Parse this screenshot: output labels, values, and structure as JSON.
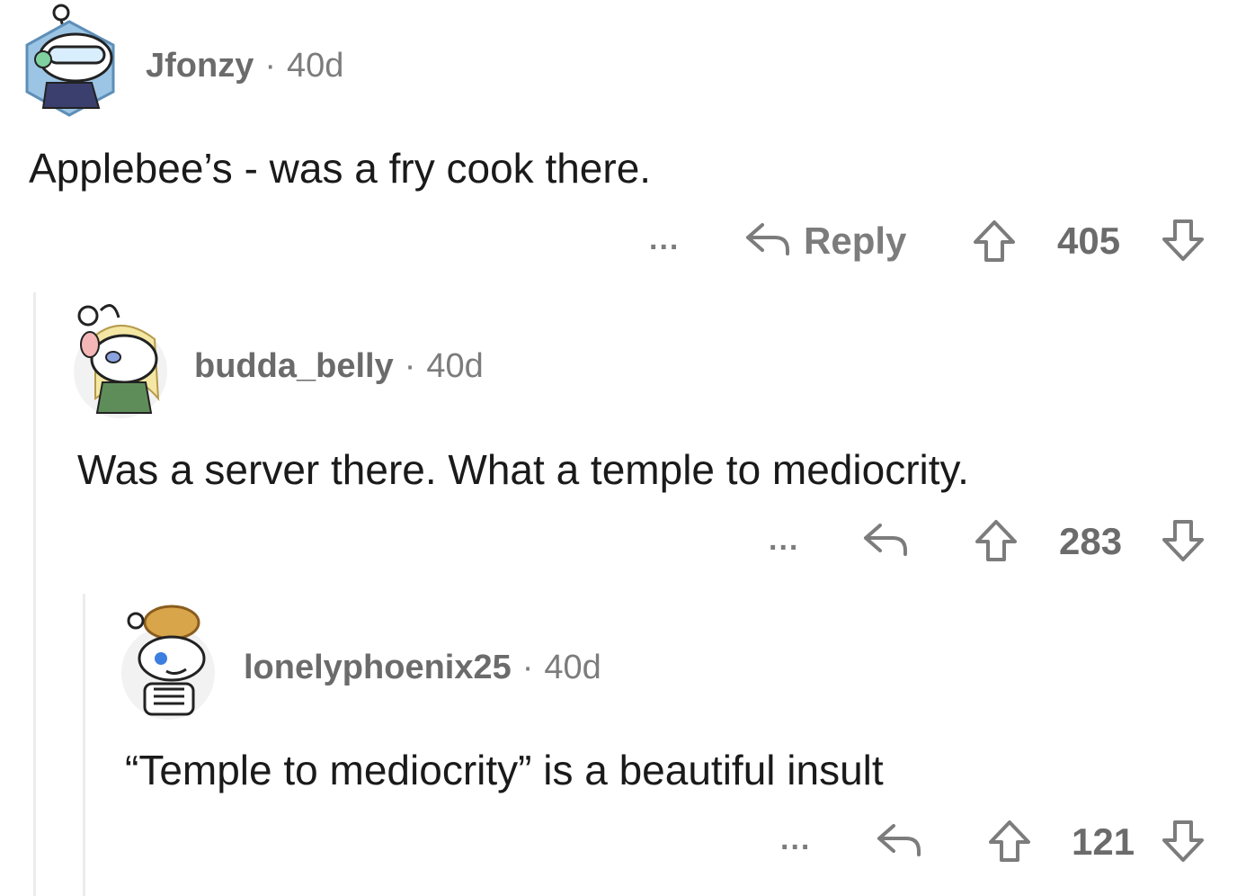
{
  "comments": [
    {
      "username": "Jfonzy",
      "age": "40d",
      "text": "Applebee’s - was a fry cook there.",
      "reply_label": "Reply",
      "more_label": "...",
      "score": "405"
    },
    {
      "username": "budda_belly",
      "age": "40d",
      "text": "Was a server there. What a temple to mediocrity.",
      "more_label": "...",
      "score": "283"
    },
    {
      "username": "lonelyphoenix25",
      "age": "40d",
      "text": "“Temple to mediocrity” is a beautiful insult",
      "more_label": "...",
      "score": "121"
    }
  ],
  "separator": "·",
  "colors": {
    "meta_text": "#7c7c7c",
    "body_text": "#1a1a1b",
    "thread_line": "#ececec"
  },
  "icons": [
    "avatar",
    "reply-arrow-icon",
    "upvote-icon",
    "downvote-icon",
    "more-options-icon"
  ]
}
